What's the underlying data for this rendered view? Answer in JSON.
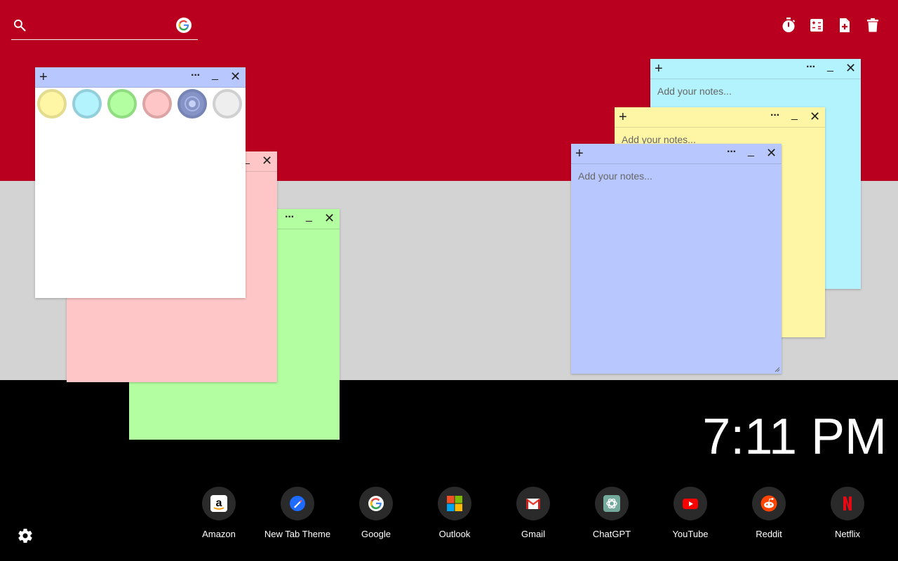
{
  "search": {
    "placeholder": "",
    "engine_icon": "google-icon"
  },
  "toolbar": {
    "icons": [
      "stopwatch-icon",
      "calculator-icon",
      "new-note-icon",
      "trash-icon"
    ]
  },
  "notes": {
    "palette_note": {
      "plus": "+",
      "more": "···",
      "min": "_",
      "close": "✕"
    },
    "pink_note": {
      "min": "_",
      "close": "✕"
    },
    "green_note": {
      "more": "···",
      "min": "_",
      "close": "✕"
    },
    "cyan_note": {
      "plus": "+",
      "more": "···",
      "min": "_",
      "close": "✕",
      "placeholder": "Add your notes..."
    },
    "yellow_note": {
      "plus": "+",
      "more": "···",
      "min": "_",
      "close": "✕",
      "placeholder": "Add your notes..."
    },
    "blue_note": {
      "plus": "+",
      "more": "···",
      "min": "_",
      "close": "✕",
      "placeholder": "Add your notes..."
    }
  },
  "palette": [
    "yellow",
    "cyan",
    "green",
    "pink",
    "blue",
    "grey"
  ],
  "colors": {
    "red_band": "#BA001F",
    "grey_band": "#D3D3D3",
    "note_yellow": "#FFF6A5",
    "note_cyan": "#B3F3FD",
    "note_green": "#B2FEA0",
    "note_pink": "#FEC6C6",
    "note_blue": "#B8C8FE",
    "note_white": "#FFFFFF"
  },
  "clock": {
    "time": "7:11 PM"
  },
  "shortcuts": [
    {
      "label": "Amazon",
      "icon": "amazon-icon"
    },
    {
      "label": "New Tab Theme",
      "icon": "new-tab-theme-icon"
    },
    {
      "label": "Google",
      "icon": "google-icon"
    },
    {
      "label": "Outlook",
      "icon": "outlook-icon"
    },
    {
      "label": "Gmail",
      "icon": "gmail-icon"
    },
    {
      "label": "ChatGPT",
      "icon": "chatgpt-icon"
    },
    {
      "label": "YouTube",
      "icon": "youtube-icon"
    },
    {
      "label": "Reddit",
      "icon": "reddit-icon"
    },
    {
      "label": "Netflix",
      "icon": "netflix-icon"
    }
  ],
  "settings": {
    "icon": "gear-icon"
  }
}
